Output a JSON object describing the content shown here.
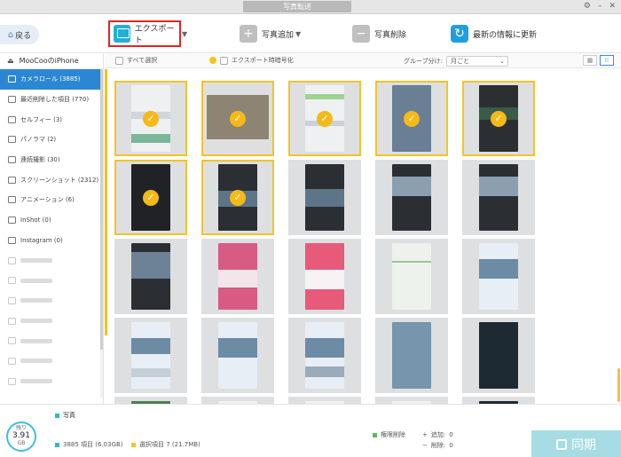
{
  "window": {
    "title": "写真転送"
  },
  "toolbar": {
    "back_label": "戻る",
    "export_label": "エクスポート",
    "add_label": "写真追加",
    "delete_label": "写真削除",
    "refresh_label": "最新の情報に更新"
  },
  "sidebar": {
    "device_name": "MooCooのiPhone",
    "items": [
      {
        "label": "カメラロール (3885)",
        "active": true
      },
      {
        "label": "最近削除した項目 (770)"
      },
      {
        "label": "セルフィー (3)"
      },
      {
        "label": "パノラマ (2)"
      },
      {
        "label": "連続撮影 (30)"
      },
      {
        "label": "スクリーンショット (2312)"
      },
      {
        "label": "アニメーション (6)"
      },
      {
        "label": "InShot (0)"
      },
      {
        "label": "Instagram (0)"
      }
    ]
  },
  "filter": {
    "select_all": "すべて選択",
    "export_encrypt": "エクスポート時暗号化",
    "group_label": "グループ分け:",
    "group_value": "月ごと"
  },
  "status": {
    "storage_top": "残り",
    "storage_value": "3.91",
    "storage_unit": "GB",
    "category": "写真",
    "total": "3885 項目 (6.03GB)",
    "selected": "選択項目 7 (21.7MB)",
    "perm_delete": "権限削除",
    "add_label": "追加:",
    "add_count": "0",
    "remove_label": "削除:",
    "remove_count": "0",
    "sync_label": "同期"
  },
  "colors": {
    "accent": "#2b87d3",
    "selection": "#f2c525",
    "export_highlight": "#e32323",
    "sync_button": "#a6dce3"
  }
}
